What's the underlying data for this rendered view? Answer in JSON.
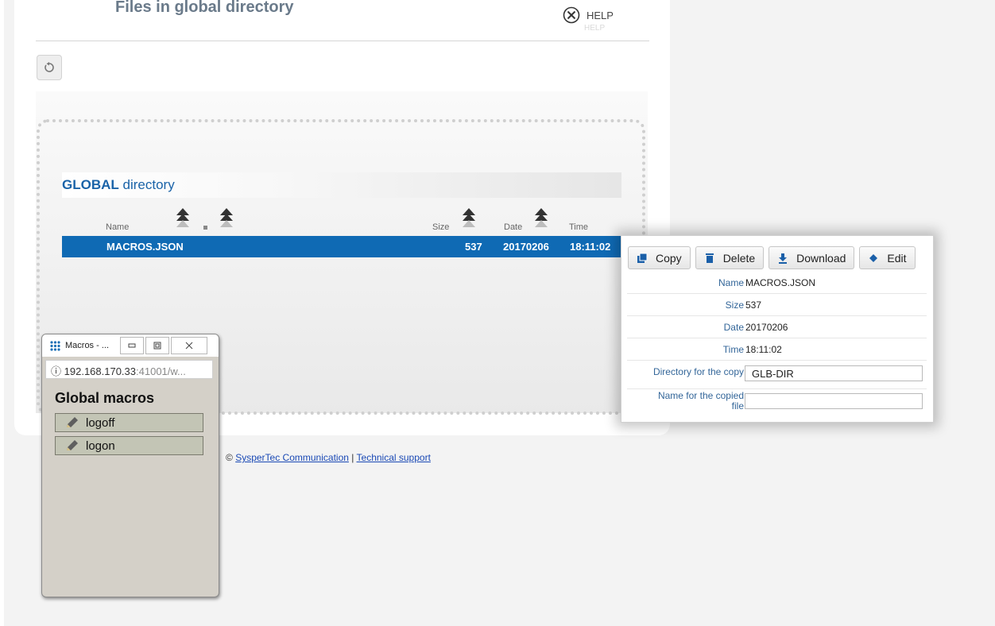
{
  "page": {
    "title": "Files in global directory",
    "help_label": "HELP",
    "help_reflection": "HELP"
  },
  "directory": {
    "title_bold": "GLOBAL",
    "title_rest": " directory",
    "columns": {
      "name": "Name",
      "size": "Size",
      "date": "Date",
      "time": "Time"
    },
    "rows": [
      {
        "name": "MACROS.JSON",
        "size": "537",
        "date": "20170206",
        "time": "18:11:02"
      }
    ]
  },
  "footer": {
    "copyright": "©",
    "company": "SysperTec Communication",
    "separator": "|",
    "support": "Technical support"
  },
  "details": {
    "buttons": {
      "copy": "Copy",
      "delete": "Delete",
      "download": "Download",
      "edit": "Edit"
    },
    "labels": {
      "name": "Name",
      "size": "Size",
      "date": "Date",
      "time": "Time",
      "copy_dir": "Directory for the copy",
      "copy_name_line1": "Name for the copied",
      "copy_name_line2": "file"
    },
    "values": {
      "name": "MACROS.JSON",
      "size": "537",
      "date": "20170206",
      "time": "18:11:02",
      "copy_dir": "GLB-DIR",
      "copy_name": ""
    }
  },
  "window": {
    "title": "Macros - ...",
    "address_main": "192.168.170.33",
    "address_rest": ":41001/w...",
    "heading": "Global macros",
    "macros": [
      "logoff",
      "logon"
    ]
  },
  "colors": {
    "selected_row": "#0f6ab4",
    "title_blue": "#1a63a8",
    "link": "#1a49b5"
  }
}
